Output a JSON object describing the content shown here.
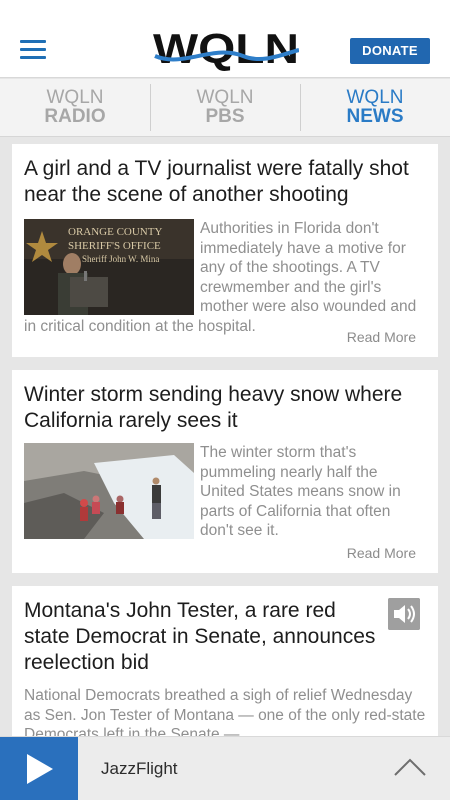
{
  "header": {
    "logo_text": "WQLN",
    "donate_label": "DONATE"
  },
  "tabs": [
    {
      "line1": "WQLN",
      "line2": "RADIO",
      "active": false
    },
    {
      "line1": "WQLN",
      "line2": "PBS",
      "active": false
    },
    {
      "line1": "WQLN",
      "line2": "NEWS",
      "active": true
    }
  ],
  "articles": [
    {
      "title": "A girl and a TV journalist were fatally shot near the scene of another shooting",
      "summary": "Authorities in Florida don't immediately have a motive for any of the shootings. A TV crewmember and the girl's mother were also wounded and in critical condition at the hospital.",
      "read_more": "Read More",
      "image_icon": "press-conference-photo"
    },
    {
      "title": "Winter storm sending heavy snow where California rarely sees it",
      "summary": "The winter storm that's pummeling nearly half the United States means snow in parts of California that often don't see it.",
      "read_more": "Read More",
      "image_icon": "snow-hillside-photo"
    },
    {
      "title": "Montana's John Tester, a rare red state Democrat in Senate, announces reelection bid",
      "summary": "National Democrats breathed a sigh of relief Wednesday as Sen. Jon Tester of Montana — one of the only red-state Democrats left in the Senate —",
      "audio_icon": "speaker-icon"
    }
  ],
  "player": {
    "station": "JazzFlight",
    "play_icon": "play-icon",
    "expand_icon": "chevron-up-icon"
  },
  "colors": {
    "brand_blue": "#2167b0",
    "active_tab": "#2a7bc6",
    "inactive_tab": "#a7a7a7",
    "background": "#e6e6e6"
  }
}
